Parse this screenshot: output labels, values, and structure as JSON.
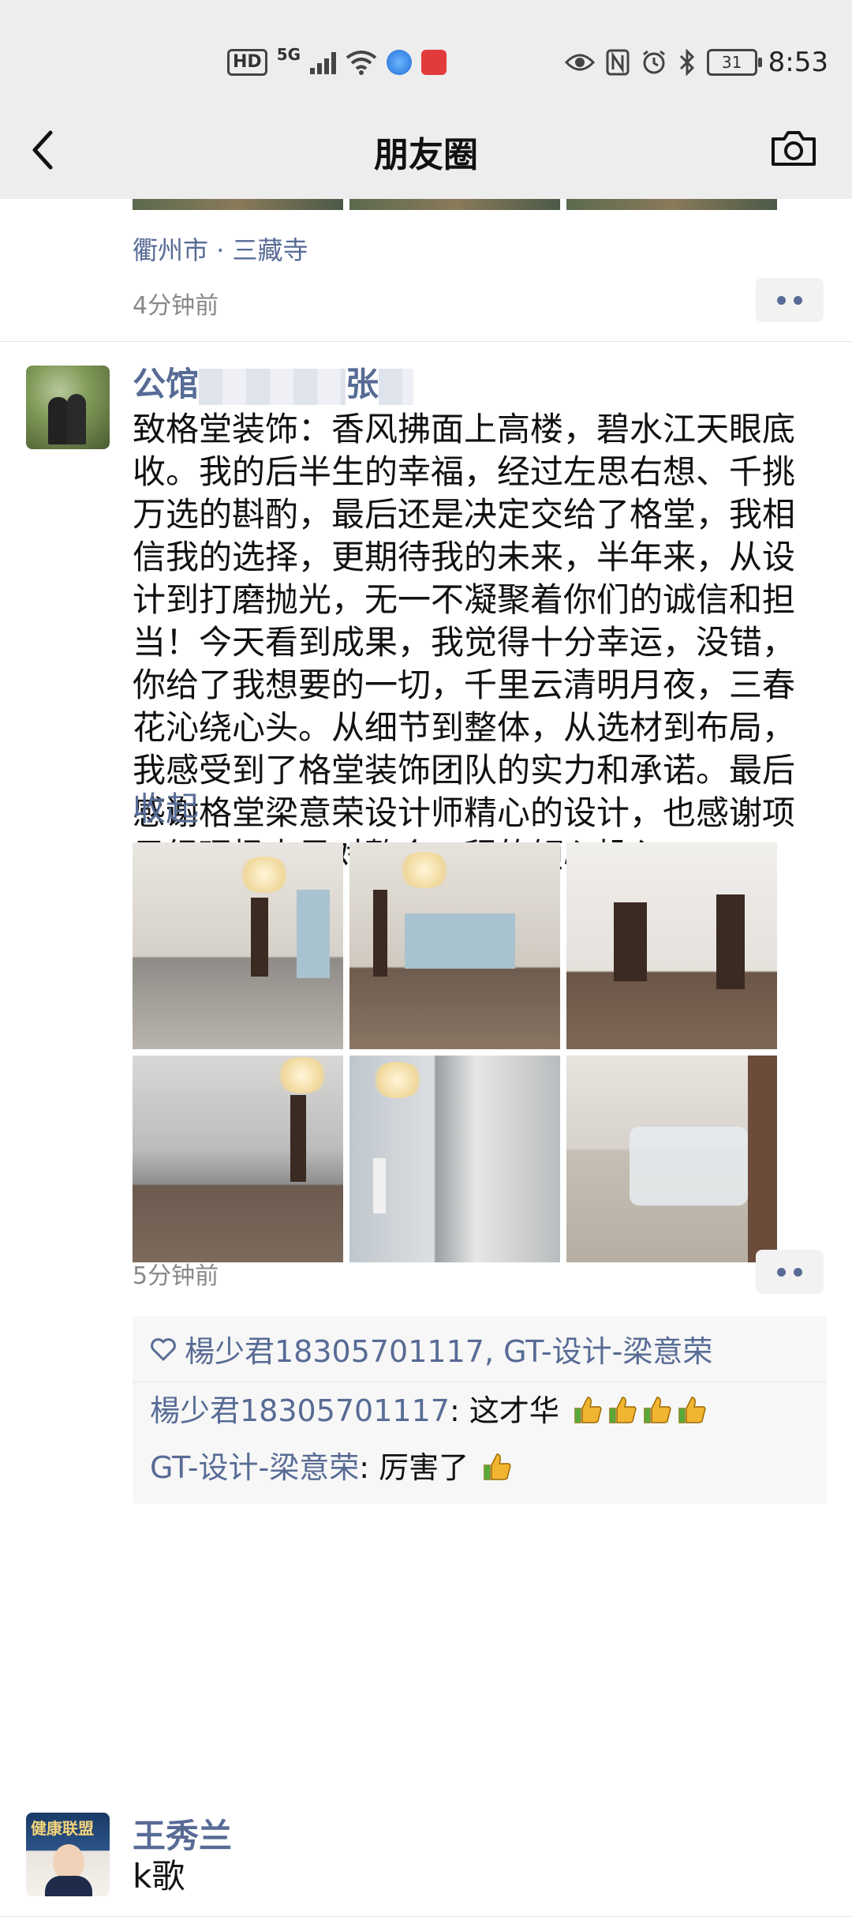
{
  "status_bar": {
    "hd": "HD",
    "network": "5G",
    "battery": "31",
    "time": "8:53"
  },
  "nav": {
    "title": "朋友圈"
  },
  "prev_post": {
    "location": "衢州市 · 三藏寺",
    "time": "4分钟前"
  },
  "post": {
    "name_prefix": "公馆",
    "name_suffix": "张",
    "body": "致格堂装饰：香风拂面上高楼，碧水江天眼底收。我的后半生的幸福，经过左思右想、千挑万选的斟酌，最后还是决定交给了格堂，我相信我的选择，更期待我的未来，半年来，从设计到打磨抛光，无一不凝聚着你们的诚信和担当！今天看到成果，我觉得十分幸运，没错，你给了我想要的一切，千里云清明月夜，三春花沁绕心头。从细节到整体，从选材到布局，我感受到了格堂装饰团队的实力和承诺。最后感谢格堂梁意荣设计师精心的设计，也感谢项目经理杨少君对整个工程的倾心投入。",
    "collapse_label": "收起",
    "time": "5分钟前",
    "likes": "楊少君18305701117, GT-设计-梁意荣",
    "comments": [
      {
        "author": "楊少君18305701117",
        "sep": ": ",
        "text": "这才华"
      },
      {
        "author": "GT-设计-梁意荣",
        "sep": ": ",
        "text": "厉害了"
      }
    ]
  },
  "next_post": {
    "name": "王秀兰",
    "body": "k歌",
    "avatar_text": "健康联盟"
  },
  "colors": {
    "link": "#576b95",
    "bar_bg": "#ededed",
    "comment_bg": "#f7f7f7"
  }
}
